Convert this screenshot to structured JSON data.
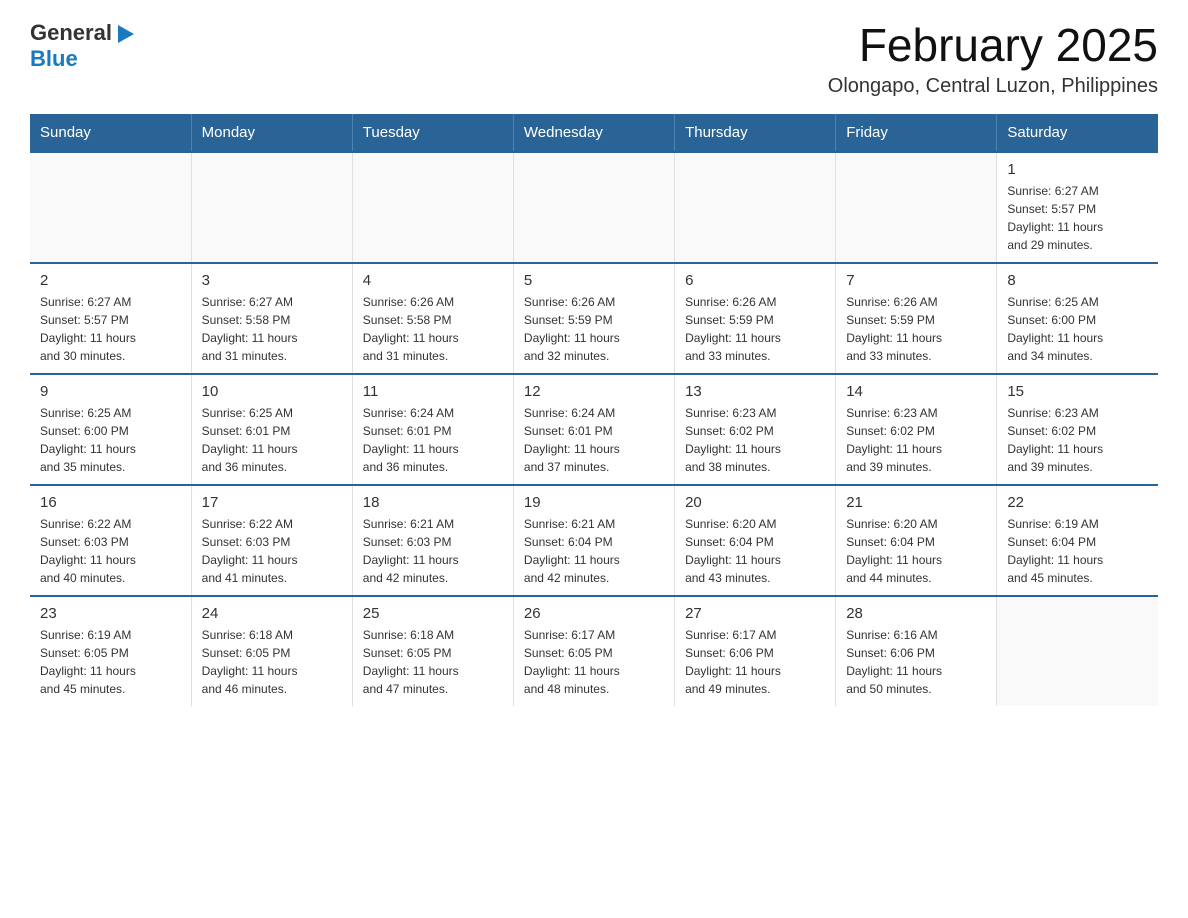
{
  "header": {
    "logo": {
      "general": "General",
      "flag_icon": "▶",
      "blue": "Blue"
    },
    "title": "February 2025",
    "subtitle": "Olongapo, Central Luzon, Philippines"
  },
  "calendar": {
    "days_of_week": [
      "Sunday",
      "Monday",
      "Tuesday",
      "Wednesday",
      "Thursday",
      "Friday",
      "Saturday"
    ],
    "weeks": [
      [
        {
          "day": "",
          "info": ""
        },
        {
          "day": "",
          "info": ""
        },
        {
          "day": "",
          "info": ""
        },
        {
          "day": "",
          "info": ""
        },
        {
          "day": "",
          "info": ""
        },
        {
          "day": "",
          "info": ""
        },
        {
          "day": "1",
          "info": "Sunrise: 6:27 AM\nSunset: 5:57 PM\nDaylight: 11 hours\nand 29 minutes."
        }
      ],
      [
        {
          "day": "2",
          "info": "Sunrise: 6:27 AM\nSunset: 5:57 PM\nDaylight: 11 hours\nand 30 minutes."
        },
        {
          "day": "3",
          "info": "Sunrise: 6:27 AM\nSunset: 5:58 PM\nDaylight: 11 hours\nand 31 minutes."
        },
        {
          "day": "4",
          "info": "Sunrise: 6:26 AM\nSunset: 5:58 PM\nDaylight: 11 hours\nand 31 minutes."
        },
        {
          "day": "5",
          "info": "Sunrise: 6:26 AM\nSunset: 5:59 PM\nDaylight: 11 hours\nand 32 minutes."
        },
        {
          "day": "6",
          "info": "Sunrise: 6:26 AM\nSunset: 5:59 PM\nDaylight: 11 hours\nand 33 minutes."
        },
        {
          "day": "7",
          "info": "Sunrise: 6:26 AM\nSunset: 5:59 PM\nDaylight: 11 hours\nand 33 minutes."
        },
        {
          "day": "8",
          "info": "Sunrise: 6:25 AM\nSunset: 6:00 PM\nDaylight: 11 hours\nand 34 minutes."
        }
      ],
      [
        {
          "day": "9",
          "info": "Sunrise: 6:25 AM\nSunset: 6:00 PM\nDaylight: 11 hours\nand 35 minutes."
        },
        {
          "day": "10",
          "info": "Sunrise: 6:25 AM\nSunset: 6:01 PM\nDaylight: 11 hours\nand 36 minutes."
        },
        {
          "day": "11",
          "info": "Sunrise: 6:24 AM\nSunset: 6:01 PM\nDaylight: 11 hours\nand 36 minutes."
        },
        {
          "day": "12",
          "info": "Sunrise: 6:24 AM\nSunset: 6:01 PM\nDaylight: 11 hours\nand 37 minutes."
        },
        {
          "day": "13",
          "info": "Sunrise: 6:23 AM\nSunset: 6:02 PM\nDaylight: 11 hours\nand 38 minutes."
        },
        {
          "day": "14",
          "info": "Sunrise: 6:23 AM\nSunset: 6:02 PM\nDaylight: 11 hours\nand 39 minutes."
        },
        {
          "day": "15",
          "info": "Sunrise: 6:23 AM\nSunset: 6:02 PM\nDaylight: 11 hours\nand 39 minutes."
        }
      ],
      [
        {
          "day": "16",
          "info": "Sunrise: 6:22 AM\nSunset: 6:03 PM\nDaylight: 11 hours\nand 40 minutes."
        },
        {
          "day": "17",
          "info": "Sunrise: 6:22 AM\nSunset: 6:03 PM\nDaylight: 11 hours\nand 41 minutes."
        },
        {
          "day": "18",
          "info": "Sunrise: 6:21 AM\nSunset: 6:03 PM\nDaylight: 11 hours\nand 42 minutes."
        },
        {
          "day": "19",
          "info": "Sunrise: 6:21 AM\nSunset: 6:04 PM\nDaylight: 11 hours\nand 42 minutes."
        },
        {
          "day": "20",
          "info": "Sunrise: 6:20 AM\nSunset: 6:04 PM\nDaylight: 11 hours\nand 43 minutes."
        },
        {
          "day": "21",
          "info": "Sunrise: 6:20 AM\nSunset: 6:04 PM\nDaylight: 11 hours\nand 44 minutes."
        },
        {
          "day": "22",
          "info": "Sunrise: 6:19 AM\nSunset: 6:04 PM\nDaylight: 11 hours\nand 45 minutes."
        }
      ],
      [
        {
          "day": "23",
          "info": "Sunrise: 6:19 AM\nSunset: 6:05 PM\nDaylight: 11 hours\nand 45 minutes."
        },
        {
          "day": "24",
          "info": "Sunrise: 6:18 AM\nSunset: 6:05 PM\nDaylight: 11 hours\nand 46 minutes."
        },
        {
          "day": "25",
          "info": "Sunrise: 6:18 AM\nSunset: 6:05 PM\nDaylight: 11 hours\nand 47 minutes."
        },
        {
          "day": "26",
          "info": "Sunrise: 6:17 AM\nSunset: 6:05 PM\nDaylight: 11 hours\nand 48 minutes."
        },
        {
          "day": "27",
          "info": "Sunrise: 6:17 AM\nSunset: 6:06 PM\nDaylight: 11 hours\nand 49 minutes."
        },
        {
          "day": "28",
          "info": "Sunrise: 6:16 AM\nSunset: 6:06 PM\nDaylight: 11 hours\nand 50 minutes."
        },
        {
          "day": "",
          "info": ""
        }
      ]
    ]
  }
}
